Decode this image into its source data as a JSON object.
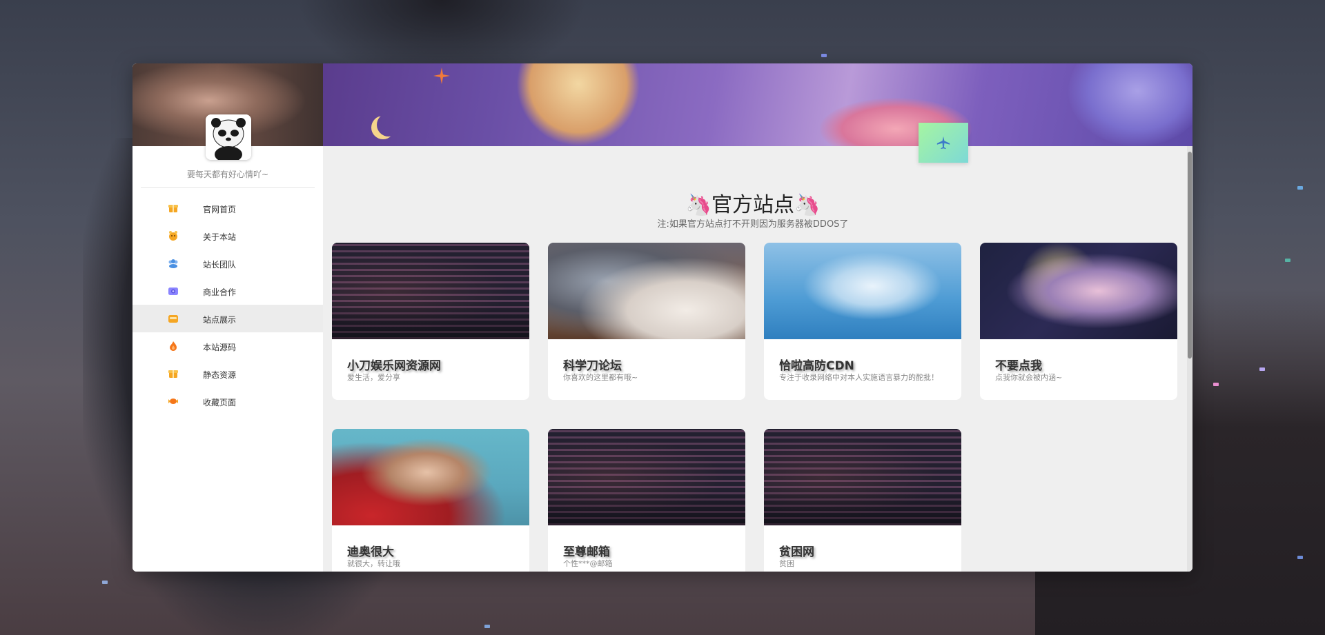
{
  "sidebar": {
    "motto": "要每天都有好心情吖~",
    "items": [
      {
        "label": "官网首页",
        "icon": "gift-box-icon",
        "color": "#f5a623"
      },
      {
        "label": "关于本站",
        "icon": "face-icon",
        "color": "#f5a623"
      },
      {
        "label": "站长团队",
        "icon": "team-icon",
        "color": "#4a90e2"
      },
      {
        "label": "商业合作",
        "icon": "camera-icon",
        "color": "#6c63ff"
      },
      {
        "label": "站点展示",
        "icon": "inbox-icon",
        "color": "#f5a623"
      },
      {
        "label": "本站源码",
        "icon": "flame-icon",
        "color": "#f5761a"
      },
      {
        "label": "静态资源",
        "icon": "gift-box-icon",
        "color": "#f5a623"
      },
      {
        "label": "收藏页面",
        "icon": "candy-icon",
        "color": "#f5761a"
      }
    ],
    "active_index": 4
  },
  "main": {
    "title": "官方站点",
    "title_emoji": "🦄",
    "note": "注:如果官方站点打不开则因为服务器被DDOS了",
    "cards": [
      {
        "title": "小刀娱乐网资源网",
        "desc": "爱生活，爱分享"
      },
      {
        "title": "科学刀论坛",
        "desc": "你喜欢的这里都有哦~"
      },
      {
        "title": "恰啦高防CDN",
        "desc": "专注于收录网络中对本人实施语言暴力的酡批！"
      },
      {
        "title": "不要点我",
        "desc": "点我你就会被内涵~"
      },
      {
        "title": "迪奥很大",
        "desc": "就很大，转让哦"
      },
      {
        "title": "至尊邮箱",
        "desc": "个性***@邮箱"
      },
      {
        "title": "贫困网",
        "desc": "贫困"
      }
    ]
  },
  "colors": {
    "accent_green": "#a6f5a1",
    "accent_teal": "#7dd9d6",
    "active_bg": "#ececec"
  }
}
